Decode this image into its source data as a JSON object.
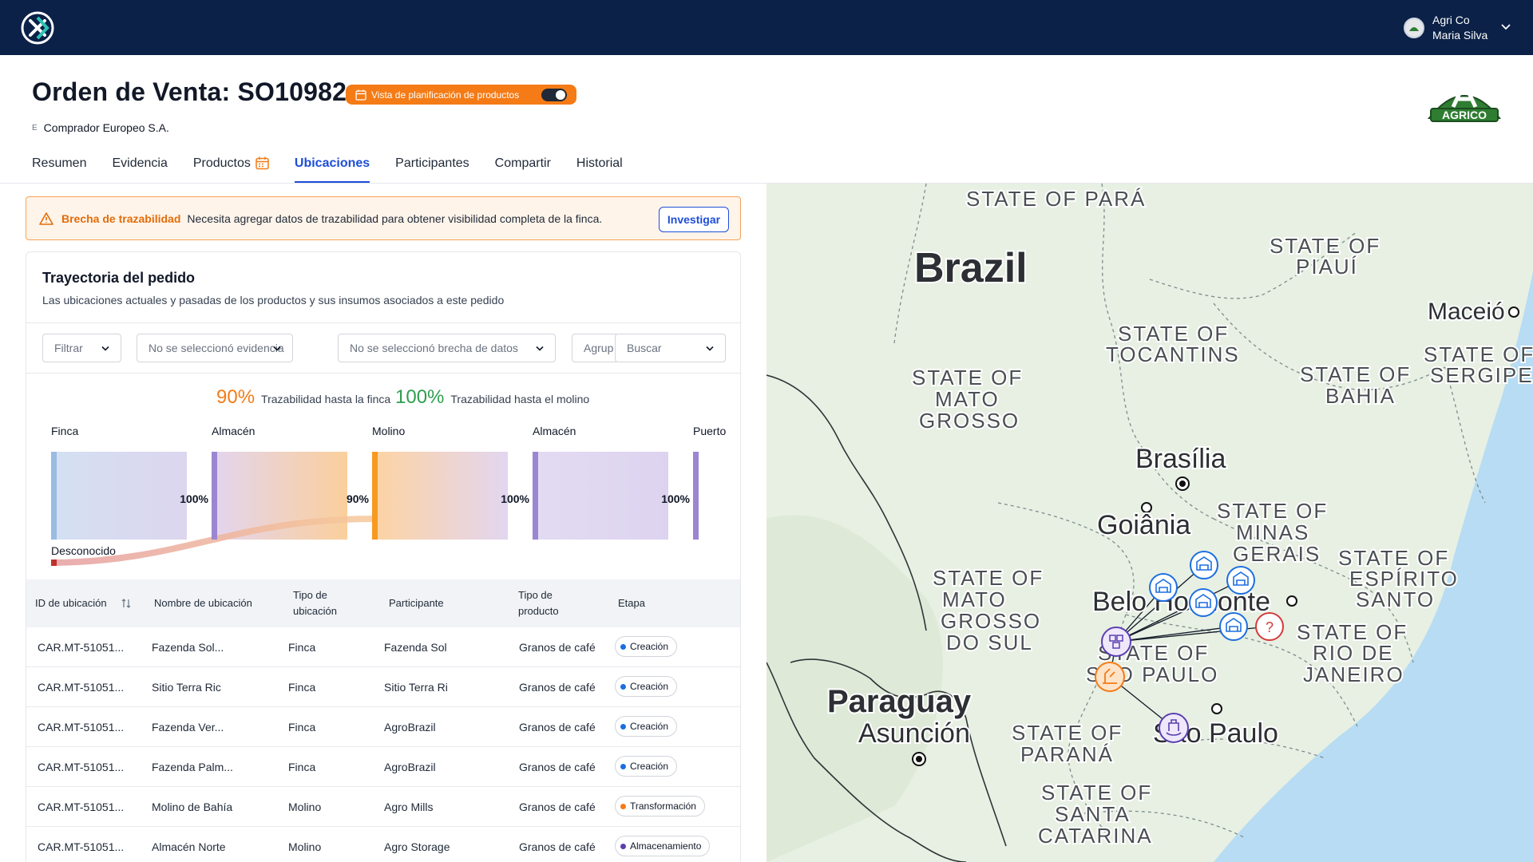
{
  "app": {
    "account": {
      "org": "Agri Co",
      "user": "Maria Silva"
    },
    "brand_logo_text": "AGRICO"
  },
  "header": {
    "title": "Orden de Venta: SO10982",
    "planning_toggle_label": "Vista de planificación de productos",
    "buyer_badge": "E",
    "buyer": "Comprador Europeo S.A."
  },
  "tabs": [
    {
      "label": "Resumen"
    },
    {
      "label": "Evidencia"
    },
    {
      "label": "Productos"
    },
    {
      "label": "Ubicaciones"
    },
    {
      "label": "Participantes"
    },
    {
      "label": "Compartir"
    },
    {
      "label": "Historial"
    }
  ],
  "alert": {
    "title": "Brecha de trazabilidad",
    "message": "Necesita agregar datos de trazabilidad para obtener visibilidad completa de la finca.",
    "button": "Investigar"
  },
  "card": {
    "title": "Trayectoria del pedido",
    "subtitle": "Las ubicaciones actuales y pasadas de los productos y sus insumos asociados a este pedido"
  },
  "filters": {
    "filter": "Filtrar",
    "evidence": "No se seleccionó evidencia",
    "data_gap": "No se seleccionó brecha de datos",
    "group": "Agrup",
    "search": "Buscar"
  },
  "metrics": [
    {
      "value": "90%",
      "label": "Trazabilidad hasta la finca",
      "color": "#f47b16"
    },
    {
      "value": "100%",
      "label": "Trazabilidad hasta el molino",
      "color": "#2e9e4f"
    }
  ],
  "sankey": {
    "stages": [
      "Finca",
      "Almacén",
      "Molino",
      "Almacén",
      "Puerto"
    ],
    "flow_labels": [
      "100%",
      "90%",
      "100%",
      "100%"
    ],
    "unknown_label": "Desconocido"
  },
  "table": {
    "headers": {
      "location_id": "ID de ubicación",
      "location_name": "Nombre de ubicación",
      "location_type": "Tipo de ubicación",
      "participant": "Participante",
      "product_type": "Tipo de producto",
      "stage": "Etapa"
    },
    "rows": [
      {
        "id": "CAR.MT-51051...",
        "name": "Fazenda Sol...",
        "type": "Finca",
        "participant": "Fazenda Sol",
        "product": "Granos de café",
        "stage": "Creación",
        "stage_color": "#1d6fe0"
      },
      {
        "id": "CAR.MT-51051...",
        "name": "Sitio Terra Ric",
        "type": "Finca",
        "participant": "Sitio Terra Ri",
        "product": "Granos de café",
        "stage": "Creación",
        "stage_color": "#1d6fe0"
      },
      {
        "id": "CAR.MT-51051...",
        "name": "Fazenda Ver...",
        "type": "Finca",
        "participant": "AgroBrazil",
        "product": "Granos de café",
        "stage": "Creación",
        "stage_color": "#1d6fe0"
      },
      {
        "id": "CAR.MT-51051...",
        "name": "Fazenda Palm...",
        "type": "Finca",
        "participant": "AgroBrazil",
        "product": "Granos de café",
        "stage": "Creación",
        "stage_color": "#1d6fe0"
      },
      {
        "id": "CAR.MT-51051...",
        "name": "Molino de Bahía",
        "type": "Molino",
        "participant": "Agro Mills",
        "product": "Granos de café",
        "stage": "Transformación",
        "stage_color": "#f47b16"
      },
      {
        "id": "CAR.MT-51051...",
        "name": "Almacén Norte",
        "type": "Molino",
        "participant": "Agro Storage",
        "product": "Granos de café",
        "stage": "Almacenamiento",
        "stage_color": "#5b3fb0"
      }
    ]
  },
  "map": {
    "labels": {
      "para": "STATE OF PARÁ",
      "piaui_1": "STATE OF",
      "piaui_2": "PIAUÍ",
      "brazil": "Brazil",
      "maceio": "Maceió",
      "tocantins_1": "STATE OF",
      "tocantins_2": "TOCANTINS",
      "sergipe_1": "STATE OF",
      "sergipe_2": "SERGIPE",
      "mato_grosso_1": "STATE OF",
      "mato_grosso_2": "MATO",
      "mato_grosso_3": "GROSSO",
      "bahia_1": "STATE OF",
      "bahia_2": "BAHIA",
      "brasilia": "Brasília",
      "goiania": "Goiânia",
      "minas_1": "STATE OF",
      "minas_2": "MINAS",
      "minas_3": "GERAIS",
      "espirito_1": "STATE OF",
      "espirito_2": "ESPÍRITO",
      "espirito_3": "SANTO",
      "ms_1": "STATE OF",
      "ms_2": "MATO",
      "ms_3": "GROSSO",
      "ms_4": "DO SUL",
      "belo": "Belo Horizonte",
      "rio_1": "STATE OF",
      "rio_2": "RIO DE",
      "rio_3": "JANEIRO",
      "sp_1": "STATE OF",
      "sp_2": "SÃO PAULO",
      "paraguay": "Paraguay",
      "asuncion": "Asunción",
      "parana_1": "STATE OF",
      "parana_2": "PARANÁ",
      "sao_paulo": "São Paulo",
      "sc_1": "STATE OF",
      "sc_2": "SANTA",
      "sc_3": "CATARINA"
    },
    "unknown_marker": "?"
  }
}
